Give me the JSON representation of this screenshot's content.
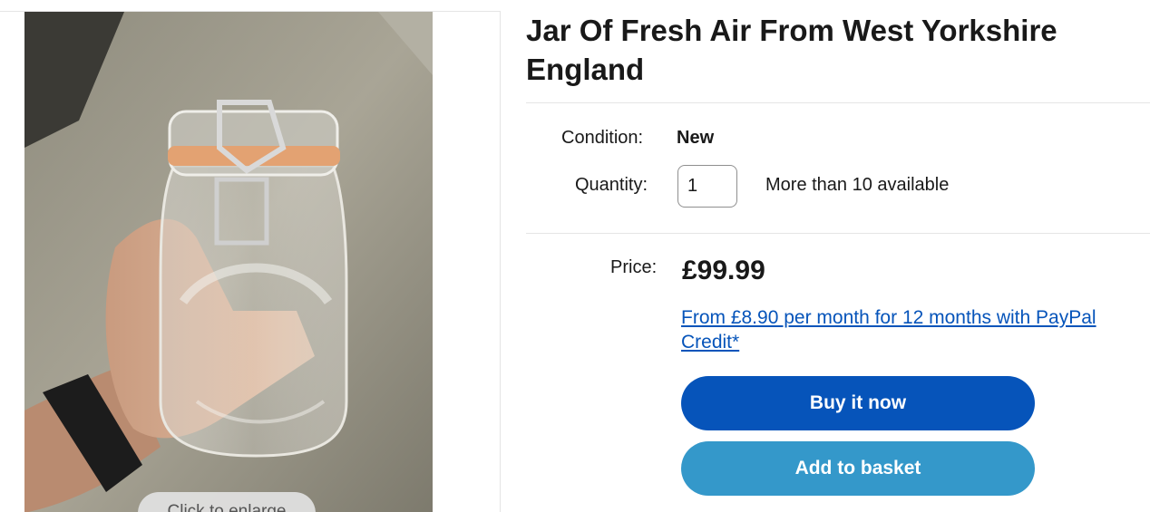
{
  "gallery": {
    "enlarge_label": "Click to enlarge",
    "image_icon": "jar-photo"
  },
  "product": {
    "title": "Jar Of Fresh Air From West Yorkshire England",
    "condition_label": "Condition:",
    "condition_value": "New",
    "quantity_label": "Quantity:",
    "quantity_value": "1",
    "availability": "More than 10 available",
    "price_label": "Price:",
    "price": "£99.99",
    "credit_link": "From £8.90 per month for 12 months with PayPal Credit*"
  },
  "actions": {
    "buy_now_label": "Buy it now",
    "add_to_basket_label": "Add to basket"
  },
  "colors": {
    "buy_now": "#0654ba",
    "add_to_basket": "#3498ca",
    "link": "#0654ba"
  }
}
